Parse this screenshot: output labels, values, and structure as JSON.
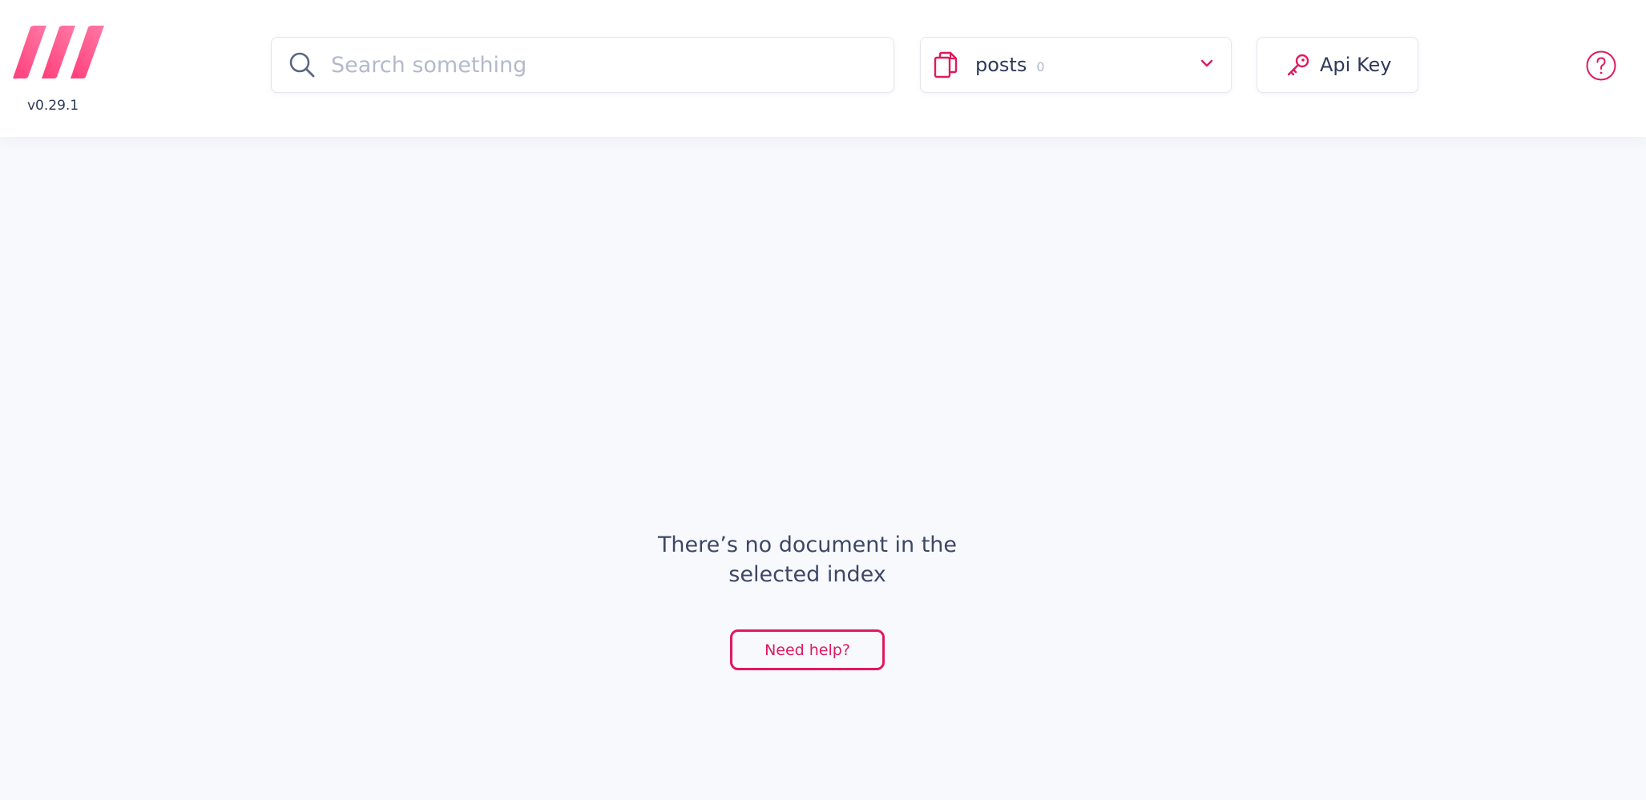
{
  "app": {
    "version": "v0.29.1",
    "logo_icon": "meilisearch-logo"
  },
  "search": {
    "placeholder": "Search something",
    "value": "",
    "icon": "search-icon"
  },
  "index_selector": {
    "icon": "documents-icon",
    "selected_index": "posts",
    "document_count": "0",
    "chevron_icon": "chevron-down-icon"
  },
  "api_key_button": {
    "icon": "key-icon",
    "label": "Api Key"
  },
  "help_icon": "help-circle-icon",
  "empty_state": {
    "message": "There’s no document in the selected index",
    "help_button_label": "Need help?"
  },
  "colors": {
    "accent": "#e0195e",
    "logo_gradient_start": "#ff4d84",
    "logo_gradient_end": "#ff7aa3",
    "text": "#2e3a5a",
    "muted_text": "#b4b9cc",
    "background": "#f8f9fd"
  }
}
